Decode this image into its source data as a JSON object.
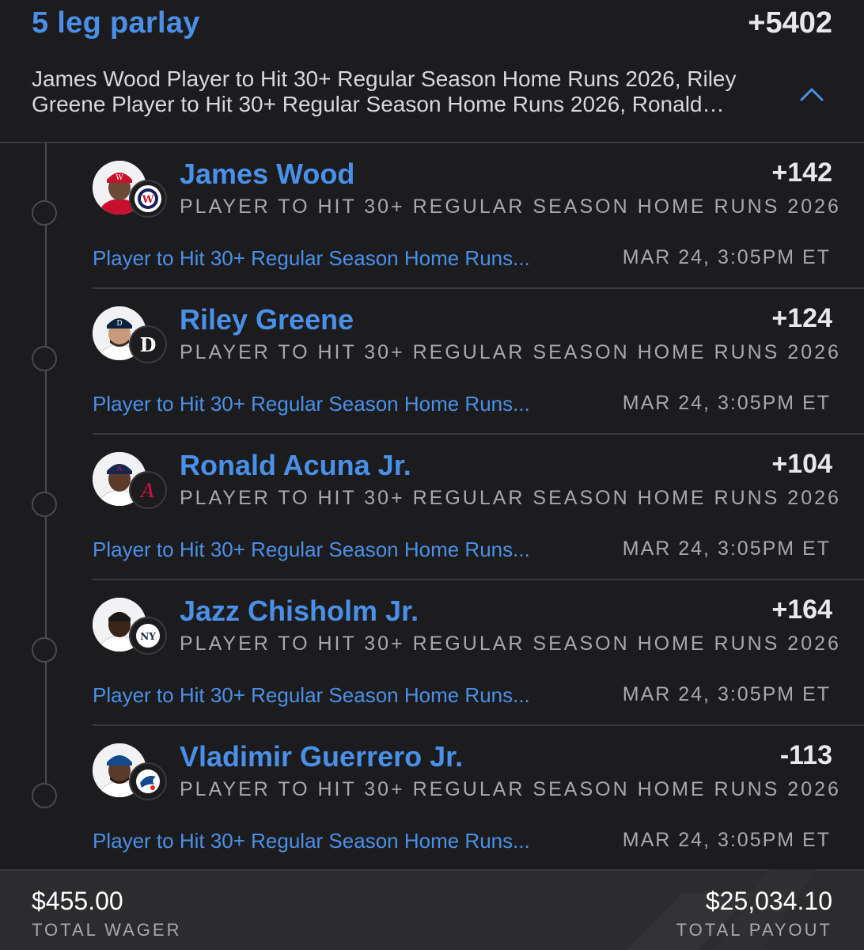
{
  "parlay": {
    "title": "5 leg parlay",
    "odds": "+5402",
    "summary": "James Wood Player to Hit 30+ Regular Season Home Runs 2026, Riley Greene Player to Hit 30+ Regular Season Home Runs 2026, Ronald…",
    "collapse_icon": "chevron-up-icon"
  },
  "legs": [
    {
      "player": "James Wood",
      "odds": "+142",
      "market": "PLAYER TO HIT 30+ REGULAR SEASON HOME RUNS 2026",
      "link": "Player to Hit 30+ Regular Season Home Runs...",
      "time": "MAR 24, 3:05PM ET",
      "team_icon": "nationals-logo-icon"
    },
    {
      "player": "Riley Greene",
      "odds": "+124",
      "market": "PLAYER TO HIT 30+ REGULAR SEASON HOME RUNS 2026",
      "link": "Player to Hit 30+ Regular Season Home Runs...",
      "time": "MAR 24, 3:05PM ET",
      "team_icon": "tigers-logo-icon"
    },
    {
      "player": "Ronald Acuna Jr.",
      "odds": "+104",
      "market": "PLAYER TO HIT 30+ REGULAR SEASON HOME RUNS 2026",
      "link": "Player to Hit 30+ Regular Season Home Runs...",
      "time": "MAR 24, 3:05PM ET",
      "team_icon": "braves-logo-icon"
    },
    {
      "player": "Jazz Chisholm Jr.",
      "odds": "+164",
      "market": "PLAYER TO HIT 30+ REGULAR SEASON HOME RUNS 2026",
      "link": "Player to Hit 30+ Regular Season Home Runs...",
      "time": "MAR 24, 3:05PM ET",
      "team_icon": "yankees-logo-icon"
    },
    {
      "player": "Vladimir Guerrero Jr.",
      "odds": "-113",
      "market": "PLAYER TO HIT 30+ REGULAR SEASON HOME RUNS 2026",
      "link": "Player to Hit 30+ Regular Season Home Runs...",
      "time": "MAR 24, 3:05PM ET",
      "team_icon": "blue-jays-logo-icon"
    }
  ],
  "footer": {
    "wager": "$455.00",
    "wager_label": "TOTAL WAGER",
    "payout": "$25,034.10",
    "payout_label": "TOTAL PAYOUT"
  },
  "colors": {
    "background": "#1c1c1e",
    "accent_blue": "#4a90e8",
    "muted_text": "#a8a8ac",
    "divider": "#3a3a3c",
    "footer_bg": "#2c2c2e"
  }
}
